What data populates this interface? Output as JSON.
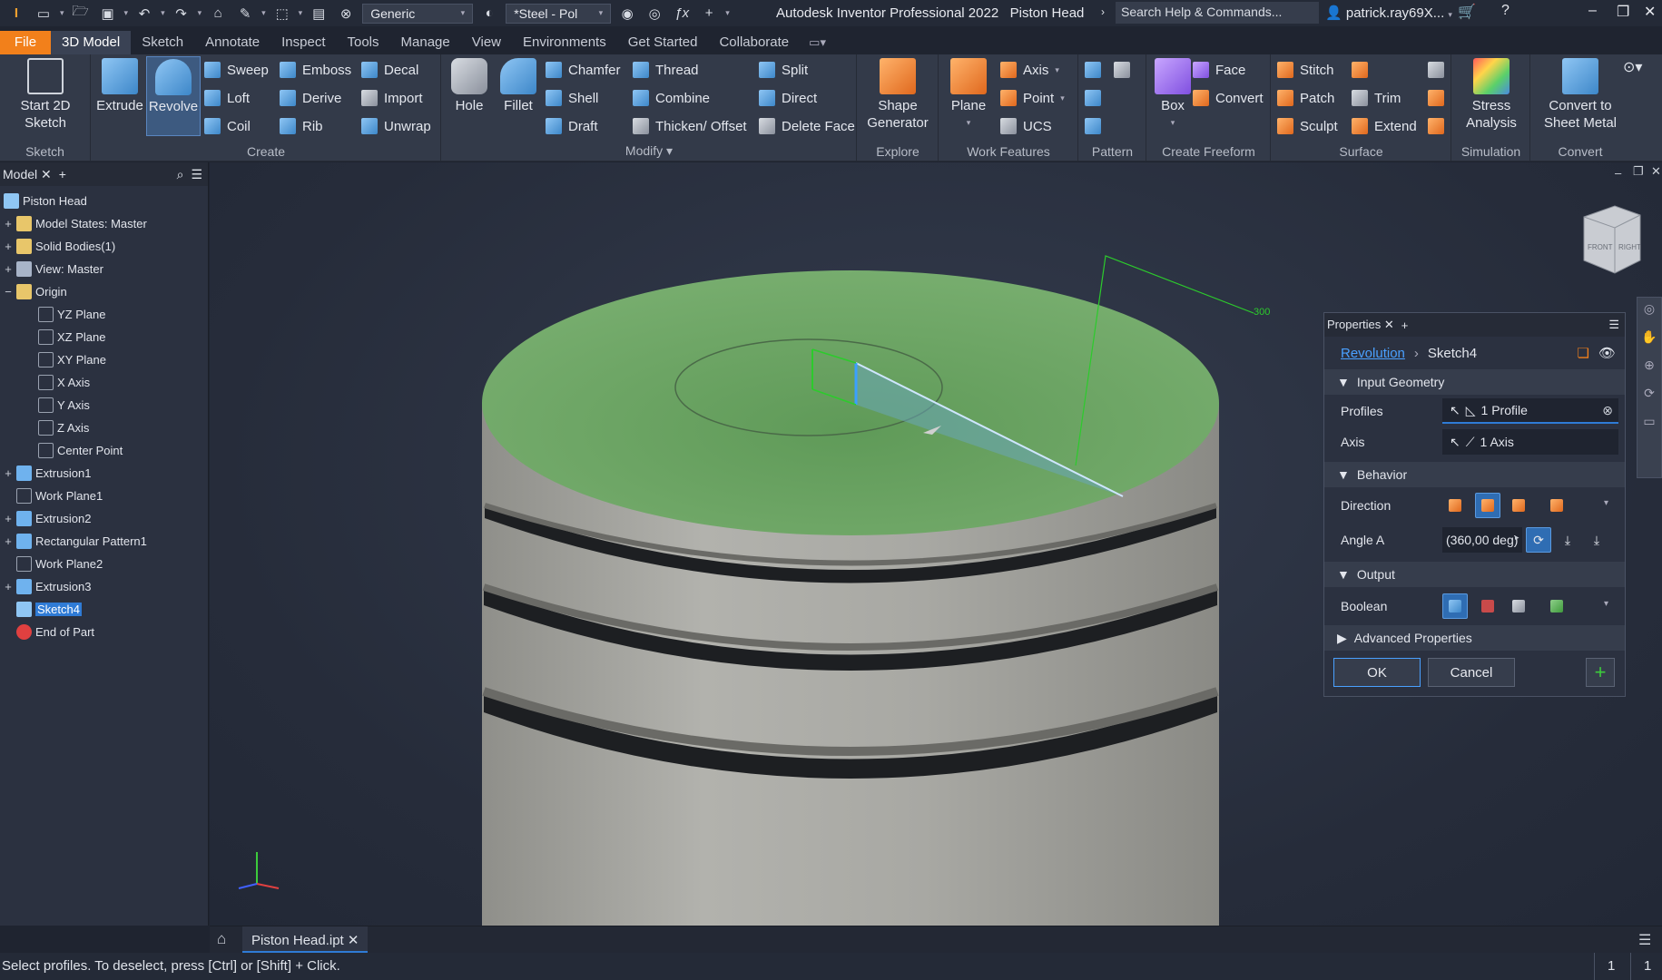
{
  "titlebar": {
    "appearance_select": "Generic",
    "material_select": "*Steel - Pol",
    "app_title": "Autodesk Inventor Professional 2022",
    "doc_title": "Piston Head",
    "search_placeholder": "Search Help & Commands...",
    "user": "patrick.ray69X..."
  },
  "menu_tabs": [
    "File",
    "3D Model",
    "Sketch",
    "Annotate",
    "Inspect",
    "Tools",
    "Manage",
    "View",
    "Environments",
    "Get Started",
    "Collaborate"
  ],
  "ribbon": {
    "sketch": {
      "label": "Sketch",
      "start_sketch": "Start 2D Sketch"
    },
    "create": {
      "label": "Create",
      "extrude": "Extrude",
      "revolve": "Revolve",
      "sweep": "Sweep",
      "loft": "Loft",
      "coil": "Coil",
      "emboss": "Emboss",
      "derive": "Derive",
      "rib": "Rib",
      "decal": "Decal",
      "import": "Import",
      "unwrap": "Unwrap"
    },
    "modify": {
      "label": "Modify",
      "hole": "Hole",
      "fillet": "Fillet",
      "chamfer": "Chamfer",
      "shell": "Shell",
      "draft": "Draft",
      "thread": "Thread",
      "combine": "Combine",
      "thicken": "Thicken/ Offset",
      "split": "Split",
      "direct": "Direct",
      "delete_face": "Delete Face"
    },
    "explore": {
      "label": "Explore",
      "shape_generator": "Shape Generator"
    },
    "work_features": {
      "label": "Work Features",
      "plane": "Plane",
      "axis": "Axis",
      "point": "Point",
      "ucs": "UCS"
    },
    "pattern": {
      "label": "Pattern"
    },
    "freeform": {
      "label": "Create Freeform",
      "box": "Box",
      "face": "Face",
      "convert": "Convert"
    },
    "surface": {
      "label": "Surface",
      "stitch": "Stitch",
      "patch": "Patch",
      "sculpt": "Sculpt",
      "trim": "Trim",
      "extend": "Extend"
    },
    "simulation": {
      "label": "Simulation",
      "stress": "Stress Analysis"
    },
    "convert": {
      "label": "Convert",
      "sheet_metal": "Convert to Sheet Metal"
    }
  },
  "browser": {
    "tab": "Model",
    "nodes": [
      {
        "label": "Piston Head",
        "expander": "",
        "icon": "part"
      },
      {
        "label": "Model States: Master",
        "expander": "+",
        "icon": "folder"
      },
      {
        "label": "Solid Bodies(1)",
        "expander": "+",
        "icon": "folder"
      },
      {
        "label": "View: Master",
        "expander": "+",
        "icon": "view"
      },
      {
        "label": "Origin",
        "expander": "−",
        "icon": "folder-open"
      },
      {
        "label": "YZ Plane",
        "expander": "",
        "icon": "plane"
      },
      {
        "label": "XZ Plane",
        "expander": "",
        "icon": "plane"
      },
      {
        "label": "XY Plane",
        "expander": "",
        "icon": "plane"
      },
      {
        "label": "X Axis",
        "expander": "",
        "icon": "axis"
      },
      {
        "label": "Y Axis",
        "expander": "",
        "icon": "axis"
      },
      {
        "label": "Z Axis",
        "expander": "",
        "icon": "axis"
      },
      {
        "label": "Center Point",
        "expander": "",
        "icon": "point"
      },
      {
        "label": "Extrusion1",
        "expander": "+",
        "icon": "feature"
      },
      {
        "label": "Work Plane1",
        "expander": "",
        "icon": "plane"
      },
      {
        "label": "Extrusion2",
        "expander": "+",
        "icon": "feature"
      },
      {
        "label": "Rectangular Pattern1",
        "expander": "+",
        "icon": "pattern"
      },
      {
        "label": "Work Plane2",
        "expander": "",
        "icon": "plane"
      },
      {
        "label": "Extrusion3",
        "expander": "+",
        "icon": "feature"
      },
      {
        "label": "Sketch4",
        "expander": "",
        "icon": "sketch",
        "selected": true
      },
      {
        "label": "End of Part",
        "expander": "",
        "icon": "end"
      }
    ]
  },
  "viewport": {
    "dimension_label": "300",
    "viewcube_front": "FRONT",
    "viewcube_right": "RIGHT"
  },
  "properties": {
    "tab": "Properties",
    "breadcrumb_feature": "Revolution",
    "breadcrumb_sketch": "Sketch4",
    "input_geometry": "Input Geometry",
    "profiles_label": "Profiles",
    "profiles_value": "1 Profile",
    "axis_label": "Axis",
    "axis_value": "1 Axis",
    "behavior": "Behavior",
    "direction_label": "Direction",
    "angle_label": "Angle A",
    "angle_value": "(360,00 deg)",
    "output": "Output",
    "boolean_label": "Boolean",
    "advanced": "Advanced Properties",
    "ok": "OK",
    "cancel": "Cancel"
  },
  "doc_tab": "Piston Head.ipt",
  "status": {
    "message": "Select profiles. To deselect, press [Ctrl] or [Shift] + Click.",
    "count1": "1",
    "count2": "1"
  }
}
